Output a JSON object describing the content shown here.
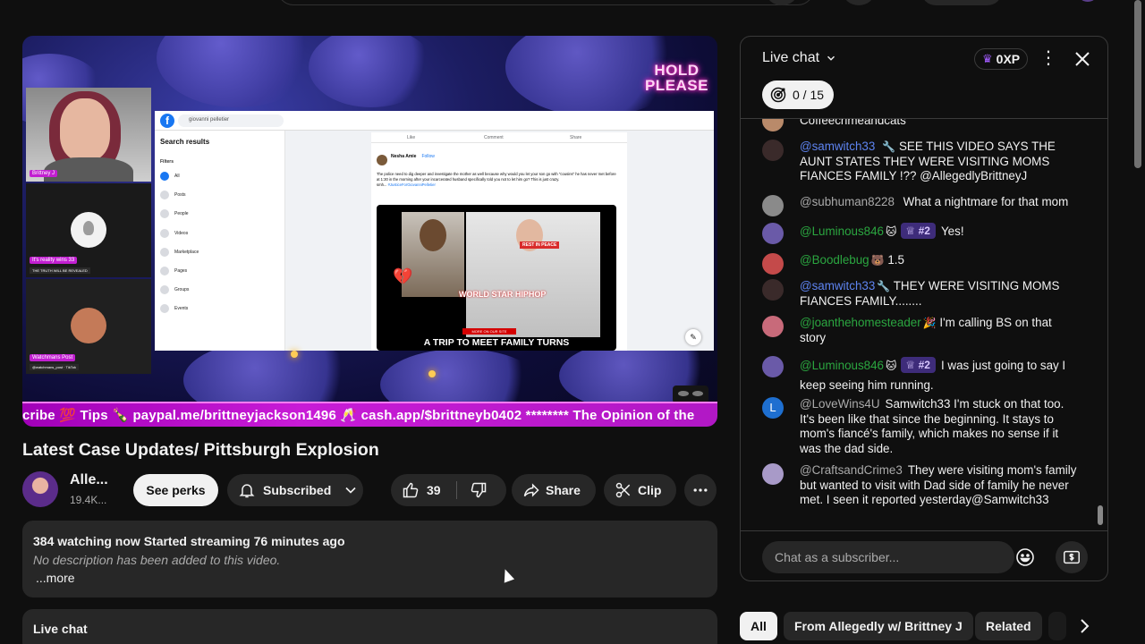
{
  "video": {
    "overlay_hold": "HOLD",
    "overlay_please": "PLEASE",
    "cam_labels": [
      "Brittney J",
      "It's reality wins 33",
      "Watchmans Post"
    ],
    "cam_sublabels": [
      "",
      "THE TRUTH WILL BE REVEALED",
      "@watchmans_post · TikTok"
    ],
    "screen": {
      "search_value": "giovanni pelletier",
      "search_results_title": "Search results",
      "filters_label": "Filters",
      "filters": [
        "All",
        "Posts",
        "People",
        "Videos",
        "Marketplace",
        "Pages",
        "Groups",
        "Events"
      ],
      "actions": [
        "Like",
        "Comment",
        "Share"
      ],
      "author": "Nesha Amie",
      "follow": "Follow",
      "post_text": "The police need to dig deeper and investigate the mother as well because why would you let your son go with \"cousins\" he has never met before at 1:30 in the morning after your incarcerated husband specifically told you not to let him go? This is just crazy.",
      "post_more": "smh...",
      "post_tag": "#JusticeForGiovanniPelletier",
      "rip_label": "REST IN PEACE",
      "media_brand": "WORLD STAR HIPHOP",
      "media_subbar": "MORE ON OUR SITE",
      "media_caption": "A TRIP TO MEET FAMILY TURNS"
    },
    "ticker": "cribe 💯 Tips 🍾 paypal.me/brittneyjackson1496 🥂 cash.app/$brittneyb0402 ******** The Opinion of the"
  },
  "title": "Latest Case Updates/ Pittsburgh Explosion",
  "channel": {
    "name": "Alle...",
    "subs": "19.4K..."
  },
  "actions": {
    "perks": "See perks",
    "subscribed": "Subscribed",
    "likes": "39",
    "share": "Share",
    "clip": "Clip"
  },
  "description": {
    "meta": "384 watching now  Started streaming 76 minutes ago",
    "empty": "No description has been added to this video.",
    "more": "...more"
  },
  "below_chat_label": "Live chat",
  "chat": {
    "title": "Live chat",
    "xp": "0XP",
    "goal": "0 / 15",
    "input_placeholder": "Chat as a subscriber...",
    "messages": [
      {
        "user": "",
        "text": "Coffeecrimeandcats",
        "color": "#f1f1f1",
        "avatar": "#b98a6a"
      },
      {
        "user": "@samwitch33",
        "emoji": "🔧",
        "text": "SEE THIS VIDEO SAYS THE AUNT STATES THEY WERE VISITING MOMS FIANCES FAMILY !?? @AllegedlyBrittneyJ",
        "avatar": "#3a2a2a"
      },
      {
        "user": "@subhuman8228",
        "text": "What a nightmare for that mom",
        "avatar": "#8a8a8a"
      },
      {
        "user": "@Luminous846",
        "emoji": "🐱",
        "rank": "#2",
        "text": "Yes!",
        "avatar": "#6a5aa8"
      },
      {
        "user": "@Boodlebug",
        "emoji": "🐻",
        "text": "1.5",
        "avatar": "#c44a4a"
      },
      {
        "user": "@samwitch33",
        "emoji": "🔧",
        "text": "THEY WERE VISITING MOMS FIANCES FAMILY........",
        "avatar": "#3a2a2a"
      },
      {
        "user": "@joanthehomesteader",
        "emoji": "🎉",
        "text": "I'm calling BS on that story",
        "avatar": "#c86a7a"
      },
      {
        "user": "@Luminous846",
        "emoji": "🐱",
        "rank": "#2",
        "text": "I was just going to say I keep seeing him running.",
        "avatar": "#6a5aa8"
      },
      {
        "user": "@LoveWins4U",
        "text": "Samwitch33 I'm stuck on that too. It's been like that since the beginning. It stays to mom's fiancé's family, which makes no sense if it was the dad side.",
        "avatar": "#1e6fd0",
        "initial": "L"
      },
      {
        "user": "@CraftsandCrime3",
        "text": "They were visiting mom's family but wanted to visit with Dad side of family he never met. I seen it reported yesterday@Samwitch33",
        "avatar": "#a89ac8"
      }
    ]
  },
  "chips": [
    "All",
    "From Allegedly w/ Brittney J",
    "Related"
  ],
  "colors": {
    "accent_green": "#2ba640",
    "accent_blue": "#5e84f1",
    "ticker_magenta": "#c81bd6",
    "rank_badge": "#3e2c7a"
  }
}
